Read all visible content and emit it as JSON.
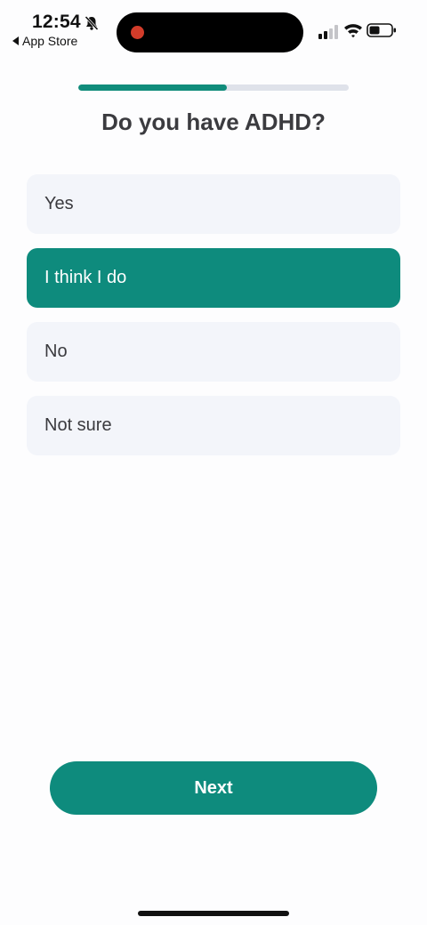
{
  "status_bar": {
    "time": "12:54",
    "back_label": "App Store",
    "icons": [
      "bell-slash-icon",
      "cellular-signal-icon",
      "wifi-icon",
      "battery-icon"
    ]
  },
  "progress": {
    "fraction": 0.55
  },
  "question": {
    "title": "Do you have ADHD?"
  },
  "options": [
    {
      "label": "Yes",
      "selected": false
    },
    {
      "label": "I think I do",
      "selected": true
    },
    {
      "label": "No",
      "selected": false
    },
    {
      "label": "Not sure",
      "selected": false
    }
  ],
  "actions": {
    "next_label": "Next"
  },
  "colors": {
    "accent": "#0e8b7d",
    "option_bg": "#f3f5fa",
    "progress_track": "#dfe2ea",
    "recording_dot": "#d23c2a"
  }
}
